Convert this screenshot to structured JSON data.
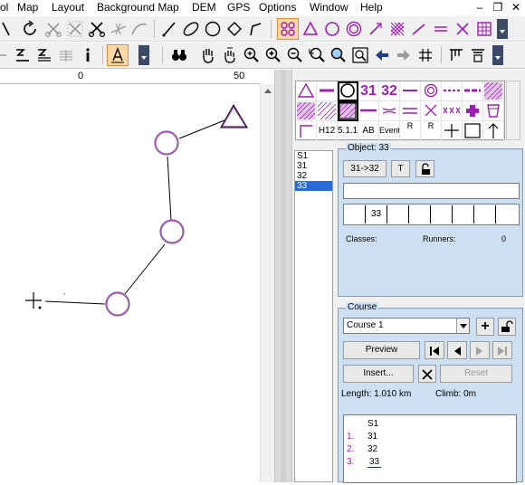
{
  "menu": [
    "ol",
    "Map",
    "Layout",
    "Background Map",
    "DEM",
    "GPS",
    "Options",
    "Window",
    "Help"
  ],
  "ruler": {
    "ticks": [
      "0",
      "50"
    ]
  },
  "symbols": {
    "row1": [
      "31",
      "32"
    ],
    "row3": [
      "H12",
      "5.1.1",
      "AB",
      "Event",
      "R",
      "R"
    ]
  },
  "control_list": [
    "S1",
    "31",
    "32",
    "33"
  ],
  "object": {
    "legend": "Object: 33",
    "leg_button": "31->32",
    "text_button": "T",
    "text_value": "",
    "code_value": "33",
    "classes_label": "Classes:",
    "runners_label": "Runners:",
    "runners_value": "0"
  },
  "course": {
    "legend": "Course",
    "selected": "Course 1",
    "preview_label": "Preview",
    "insert_label": "Insert...",
    "reset_label": "Reset",
    "length": "Length: 1.010 km",
    "climb": "Climb: 0m",
    "items": [
      {
        "num": "",
        "code": "S1"
      },
      {
        "num": "1.",
        "code": "31"
      },
      {
        "num": "2.",
        "code": "32"
      },
      {
        "num": "3.",
        "code": "33"
      }
    ]
  },
  "colors": {
    "course_purple": "#9b1fb0",
    "selection_blue": "#2a6bd6",
    "panel_blue": "#cde0f3",
    "active_tool": "#ffd7a6"
  }
}
